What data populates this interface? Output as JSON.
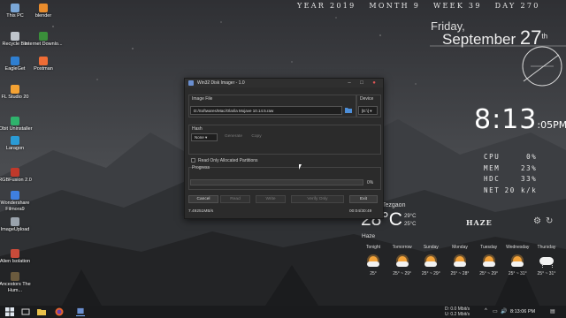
{
  "desktop_icons": [
    {
      "label": "This PC",
      "color": "#7aa7d8"
    },
    {
      "label": "blender",
      "color": "#e98c2c"
    },
    {
      "label": "Recycle Bin",
      "color": "#bfc5cc"
    },
    {
      "label": "Internet Downlo...",
      "color": "#3a8f3a"
    },
    {
      "label": "EagleGet",
      "color": "#2f7fd1"
    },
    {
      "label": "Postman",
      "color": "#ef6c35"
    },
    {
      "label": "FL Studio 20",
      "color": "#f4a233"
    },
    {
      "label": "IObit Uninstaller",
      "color": "#2fb36c"
    },
    {
      "label": "Laragon",
      "color": "#2a9bd6"
    },
    {
      "label": "RGBFusion 2.0",
      "color": "#c0392b"
    },
    {
      "label": "Wondershare Filmora9",
      "color": "#3f7fe0"
    },
    {
      "label": "ImageUpload",
      "color": "#9aa3ad"
    },
    {
      "label": "Alien Isolation",
      "color": "#c94b3a"
    },
    {
      "label": "Ancestors The Hum...",
      "color": "#6b5b3e"
    }
  ],
  "rainmeter": {
    "topbar": {
      "year": "YEAR 2019",
      "month": "MONTH 9",
      "week": "WEEK 39",
      "day": "DAY 270"
    },
    "day_name": "Friday,",
    "month_name": "September",
    "date_num": "27",
    "date_suffix": "th",
    "time": "8:13",
    "seconds": ":05",
    "ampm": "PM",
    "stats": [
      {
        "label": "CPU",
        "value": "0%"
      },
      {
        "label": "MEM",
        "value": "23%"
      },
      {
        "label": "HDC",
        "value": "33%"
      },
      {
        "label": "NET",
        "value": "20 k/k"
      }
    ]
  },
  "weather": {
    "city": "Tezgaon",
    "temp": "28°C",
    "hi": "29°C",
    "lo": "25°C",
    "condition": "Haze",
    "condition_caps": "HAZE",
    "forecast": [
      {
        "day": "Tonight",
        "range": "25°",
        "icon": "sun-cloud-icon"
      },
      {
        "day": "Tomorrow",
        "range": "25° ~ 29°",
        "icon": "sun-cloud-icon"
      },
      {
        "day": "Sunday",
        "range": "25° ~ 29°",
        "icon": "sun-cloud-icon"
      },
      {
        "day": "Monday",
        "range": "25° ~ 28°",
        "icon": "sun-cloud-icon"
      },
      {
        "day": "Tuesday",
        "range": "25° ~ 29°",
        "icon": "sun-cloud-icon"
      },
      {
        "day": "Wednesday",
        "range": "25° ~ 31°",
        "icon": "sun-cloud-icon"
      },
      {
        "day": "Thursday",
        "range": "25° ~ 31°",
        "icon": "rain-cloud-icon"
      }
    ]
  },
  "dialog": {
    "title": "Win32 Disk Imager - 1.0",
    "image_file_label": "Image File",
    "image_file_value": "D:/Softwares/Mac/Olarila Mojave 10.14.5.raw",
    "device_label": "Device",
    "device_value": "[E:\\]",
    "hash_label": "Hash",
    "hash_select": "None",
    "generate_label": "Generate",
    "copy_label": "Copy",
    "read_only_label": "Read Only Allocated Partitions",
    "progress_label": "Progress",
    "progress_percent": "0%",
    "progress_value": 0,
    "buttons": {
      "cancel": "Cancel",
      "read": "Read",
      "write": "Write",
      "verify": "Verify Only",
      "exit": "Exit"
    },
    "speed": "7.49251MB/s",
    "elapsed": "00:04/30:49"
  },
  "taskbar": {
    "net_down": "D:    0.0 Mbit/s",
    "net_up": "U:    0.2 Mbit/s",
    "clock": "8:13:06 PM"
  }
}
